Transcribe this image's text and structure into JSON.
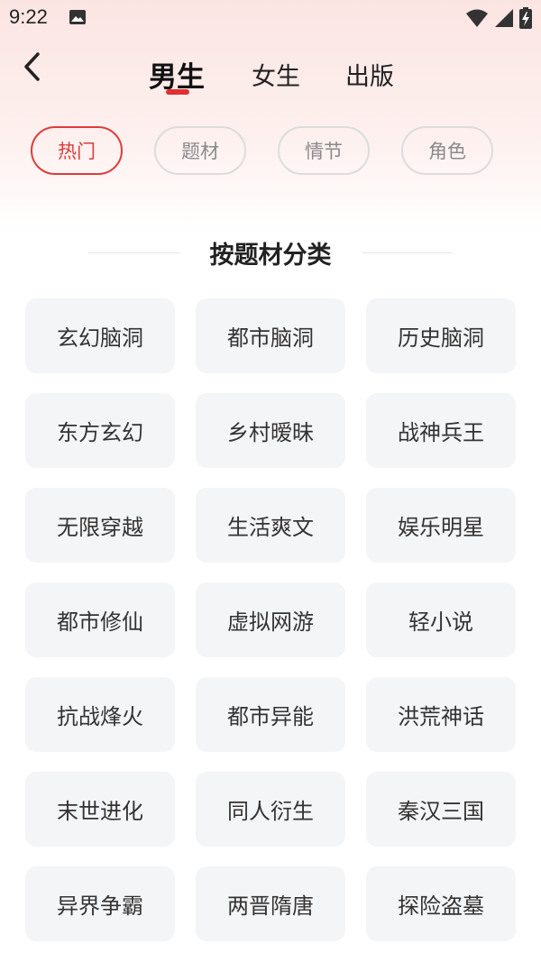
{
  "status_bar": {
    "time": "9:22",
    "icons": [
      "image-icon",
      "wifi-icon",
      "signal-icon",
      "battery-charging-icon"
    ]
  },
  "header": {
    "back_icon": "chevron-left-icon",
    "tabs": [
      {
        "label": "男生",
        "active": true
      },
      {
        "label": "女生",
        "active": false
      },
      {
        "label": "出版",
        "active": false
      }
    ],
    "accent_color": "#e23030"
  },
  "filters": [
    {
      "label": "热门",
      "active": true
    },
    {
      "label": "题材",
      "active": false
    },
    {
      "label": "情节",
      "active": false
    },
    {
      "label": "角色",
      "active": false
    }
  ],
  "section": {
    "title": "按题材分类"
  },
  "categories": [
    "玄幻脑洞",
    "都市脑洞",
    "历史脑洞",
    "东方玄幻",
    "乡村暧昧",
    "战神兵王",
    "无限穿越",
    "生活爽文",
    "娱乐明星",
    "都市修仙",
    "虚拟网游",
    "轻小说",
    "抗战烽火",
    "都市异能",
    "洪荒神话",
    "末世进化",
    "同人衍生",
    "秦汉三国",
    "异界争霸",
    "两晋隋唐",
    "探险盗墓"
  ]
}
